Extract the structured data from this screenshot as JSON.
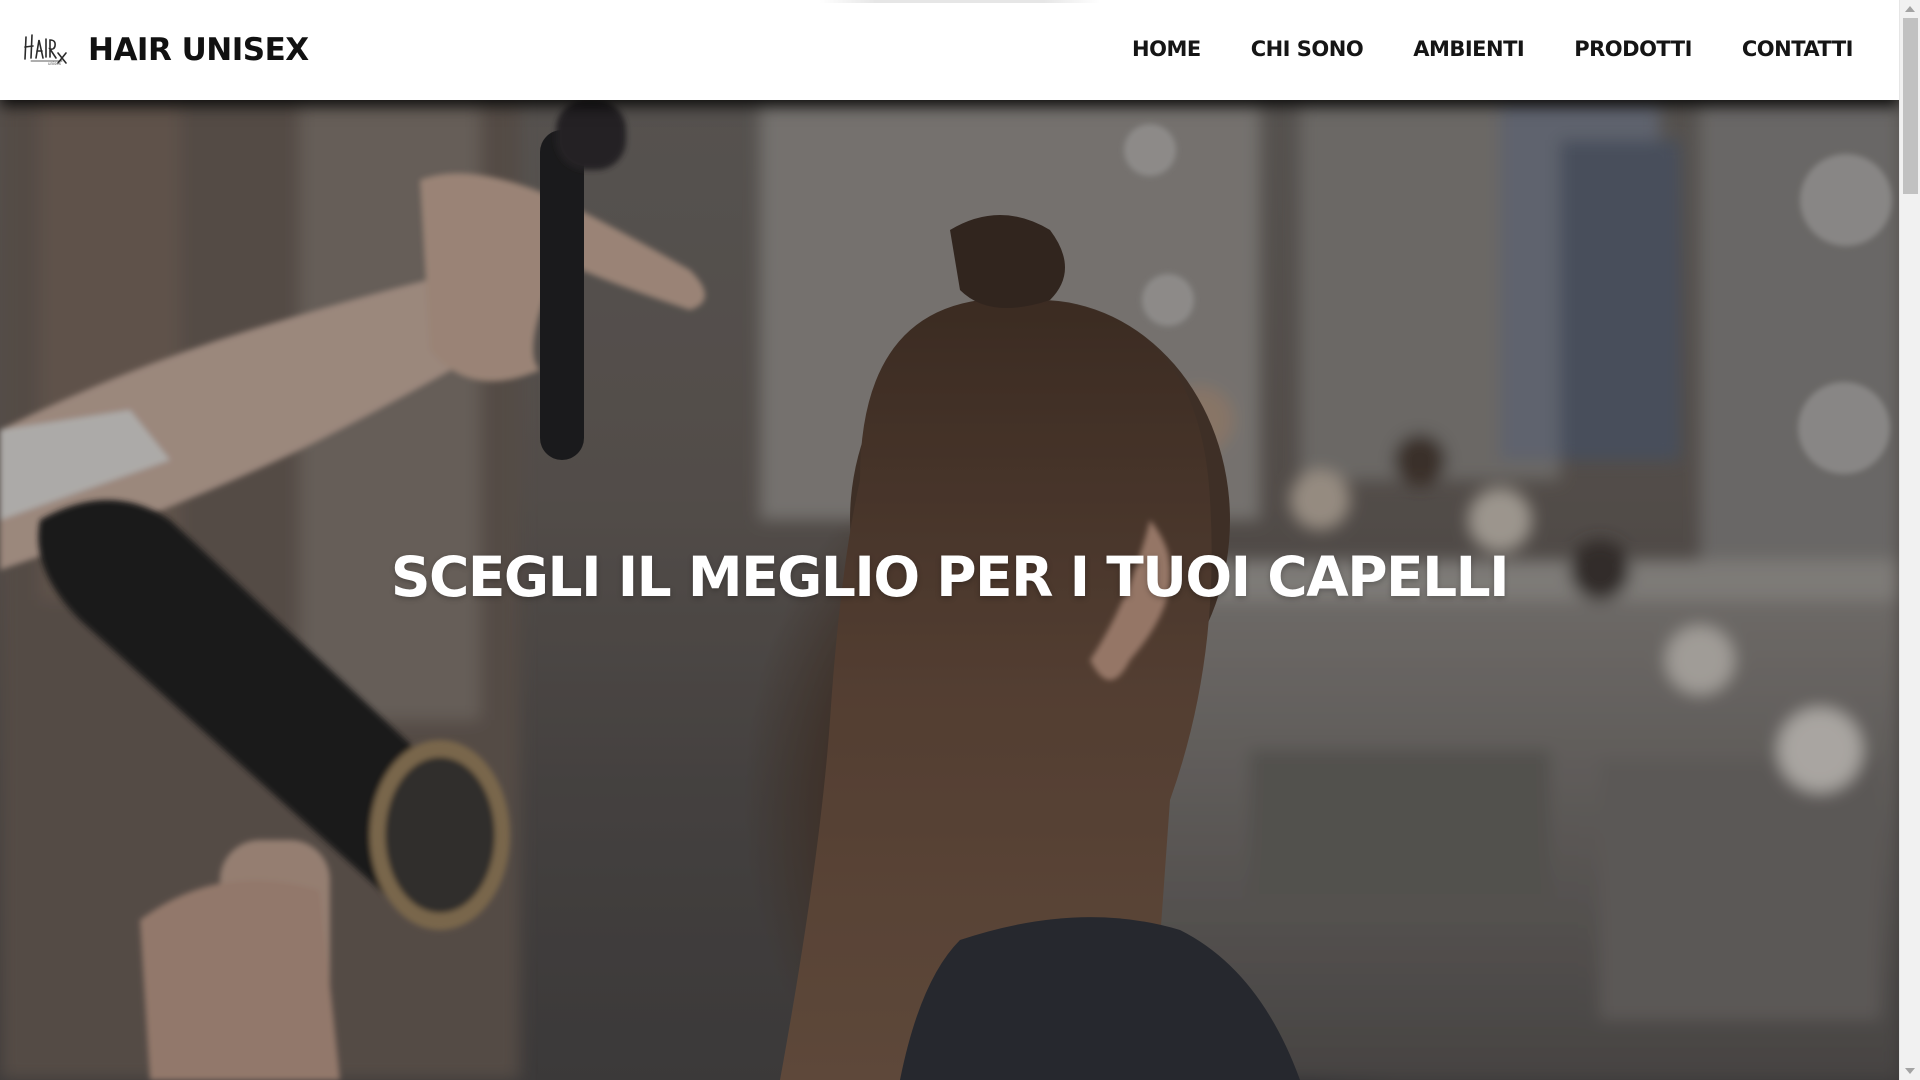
{
  "header": {
    "brand": "HAIR UNISEX",
    "logo_icon": "hair-unisex-logo",
    "nav": [
      {
        "label": "HOME"
      },
      {
        "label": "CHI SONO"
      },
      {
        "label": "AMBIENTI"
      },
      {
        "label": "PRODOTTI"
      },
      {
        "label": "CONTATTI"
      }
    ]
  },
  "hero": {
    "title": "SCEGLI IL MEGLIO PER I TUOI CAPELLI",
    "image": "hairdresser-styling-woman-long-brown-hair-photo",
    "overlay_color": "#141416"
  },
  "colors": {
    "header_bg": "#ffffff",
    "text_dark": "#111111",
    "hero_text": "#ffffff"
  }
}
